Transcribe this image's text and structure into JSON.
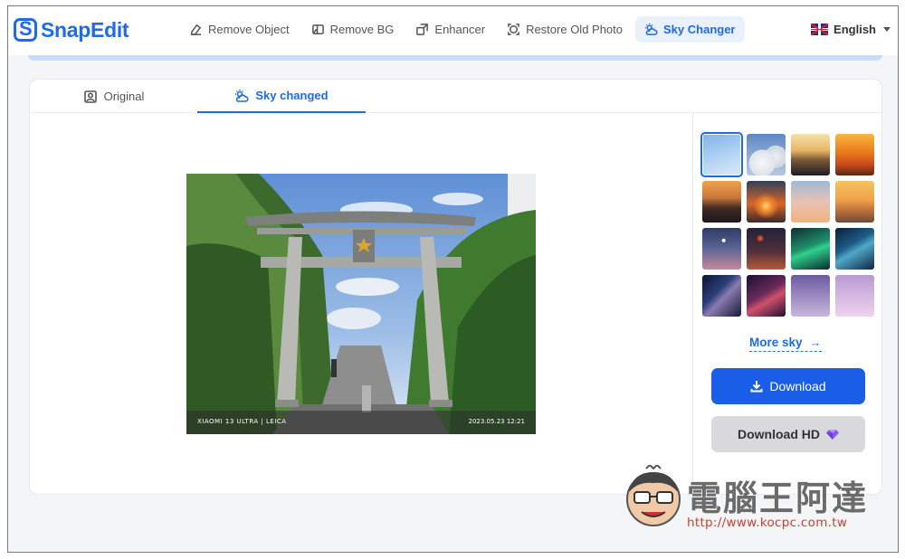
{
  "app": {
    "brand": "SnapEdit",
    "brand_color": "#1f6ae5"
  },
  "nav": {
    "items": [
      {
        "label": "Remove Object",
        "icon": "eraser-icon"
      },
      {
        "label": "Remove BG",
        "icon": "image-icon"
      },
      {
        "label": "Enhancer",
        "icon": "enlarge-icon"
      },
      {
        "label": "Restore Old Photo",
        "icon": "face-scan-icon"
      },
      {
        "label": "Sky Changer",
        "icon": "weather-icon",
        "active": true
      }
    ],
    "language": "English",
    "language_icon": "uk-flag-icon"
  },
  "tabs": [
    {
      "label": "Original",
      "icon": "portrait-icon"
    },
    {
      "label": "Sky changed",
      "icon": "weather-icon",
      "active": true
    }
  ],
  "photo": {
    "caption_left": "XIAOMI 13 ULTRA | LEICA",
    "caption_right": "2023.05.23 12:21"
  },
  "sky_options": {
    "selected_index": 0,
    "swatches": [
      "sky-blue-clear",
      "white-clouds",
      "golden-sunset-horizon",
      "orange-sunset",
      "dusk-dark-clouds",
      "sunset-ocean",
      "soft-pink-clouds",
      "warm-sunrise",
      "moon-night",
      "red-moon",
      "green-aurora",
      "blue-aurora",
      "milky-way-stars",
      "purple-galaxy",
      "violet-haze",
      "pink-lilac"
    ]
  },
  "actions": {
    "more_sky": "More sky",
    "download": "Download",
    "download_hd": "Download HD",
    "download_color": "#1a5ee8"
  },
  "watermark": {
    "title": "電腦王阿達",
    "url": "http://www.kocpc.com.tw"
  }
}
